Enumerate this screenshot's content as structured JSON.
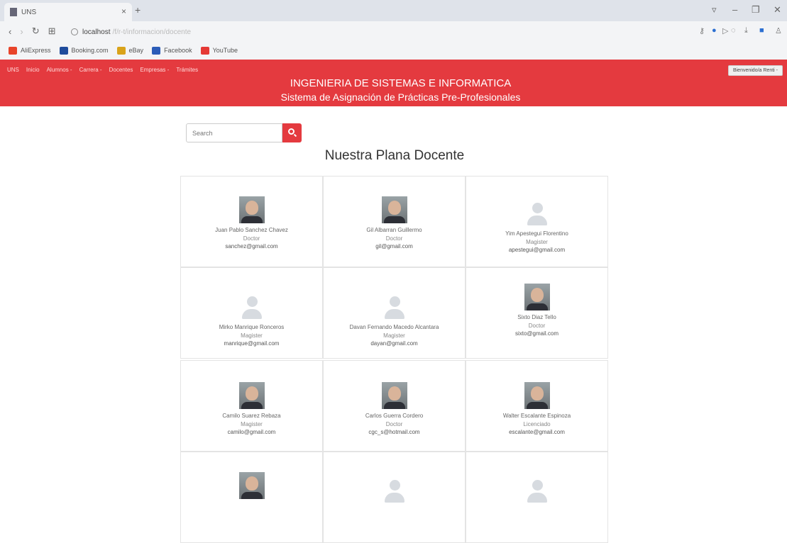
{
  "browser": {
    "tab_title": "UNS",
    "tab_close": "×",
    "new_tab": "+",
    "url_host": "localhost",
    "url_path": "/f/r-t/informacion/docente",
    "bookmarks": [
      "AliExpress",
      "Booking.com",
      "eBay",
      "Facebook",
      "YouTube"
    ]
  },
  "nav": {
    "items": [
      "UNS",
      "Inicio",
      "Alumnos -",
      "Carrera -",
      "Docentes",
      "Empresas -",
      "Trámites"
    ],
    "user_button": "Bienvenido/a Renti -"
  },
  "header": {
    "title": "INGENIERIA DE SISTEMAS E INFORMATICA",
    "subtitle": "Sistema de Asignación de Prácticas Pre-Profesionales"
  },
  "search": {
    "placeholder": "Search"
  },
  "section_title": "Nuestra Plana Docente",
  "teachers": [
    {
      "name": "Juan Pablo Sanchez Chavez",
      "degree": "Doctor",
      "email": "sanchez@gmail.com",
      "photo": "photo"
    },
    {
      "name": "Gil Albarran Guillermo",
      "degree": "Doctor",
      "email": "gil@gmail.com",
      "photo": "photo"
    },
    {
      "name": "Yim Apestegui Florentino",
      "degree": "Magister",
      "email": "apestegui@gmail.com",
      "photo": "placeholder"
    },
    {
      "name": "Mirko Manrique Ronceros",
      "degree": "Magister",
      "email": "manrique@gmail.com",
      "photo": "placeholder"
    },
    {
      "name": "Davan Fernando Macedo Alcantara",
      "degree": "Magister",
      "email": "dayan@gmail.com",
      "photo": "placeholder"
    },
    {
      "name": "Sixto Diaz Tello",
      "degree": "Doctor",
      "email": "sixto@gmail.com",
      "photo": "photo"
    },
    {
      "name": "Camilo Suarez Rebaza",
      "degree": "Magister",
      "email": "camilo@gmail.com",
      "photo": "photo"
    },
    {
      "name": "Carlos Guerra Cordero",
      "degree": "Doctor",
      "email": "cgc_s@hotmail.com",
      "photo": "photo"
    },
    {
      "name": "Walter Escalante Espinoza",
      "degree": "Licenciado",
      "email": "escalante@gmail.com",
      "photo": "photo"
    }
  ]
}
